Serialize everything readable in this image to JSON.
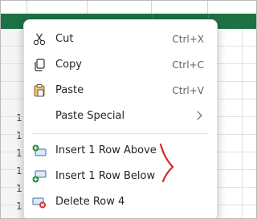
{
  "sheet": {
    "row_numbers": [
      "",
      "",
      "",
      "1",
      "1",
      "1",
      "1",
      "1",
      "1",
      "1",
      "1"
    ],
    "colors": {
      "selection": "#1e7145",
      "gridline": "#e1e1e1"
    }
  },
  "context_menu": {
    "items": [
      {
        "label": "Cut",
        "shortcut": "Ctrl+X",
        "icon": "scissors-icon"
      },
      {
        "label": "Copy",
        "shortcut": "Ctrl+C",
        "icon": "copy-icon"
      },
      {
        "label": "Paste",
        "shortcut": "Ctrl+V",
        "icon": "clipboard-icon"
      },
      {
        "label": "Paste Special",
        "shortcut": "",
        "icon": "",
        "submenu": true
      },
      {
        "label": "Insert 1 Row Above",
        "shortcut": "",
        "icon": "insert-row-above-icon"
      },
      {
        "label": "Insert 1 Row Below",
        "shortcut": "",
        "icon": "insert-row-below-icon"
      },
      {
        "label": "Delete Row 4",
        "shortcut": "",
        "icon": "delete-row-icon"
      }
    ]
  },
  "annotation": {
    "color": "#d42a2a"
  }
}
